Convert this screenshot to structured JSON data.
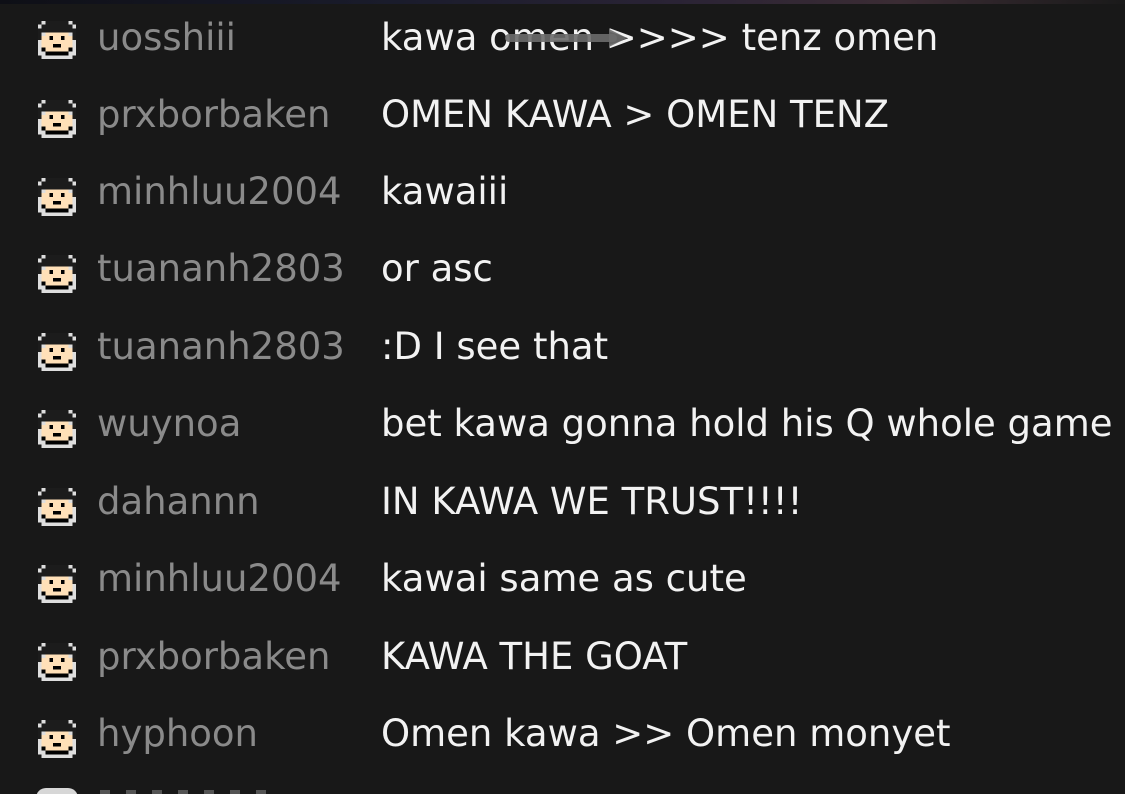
{
  "chat": {
    "messages": [
      {
        "username": "uosshiii",
        "text": "kawa omen >>>> tenz omen",
        "avatar": "pixel-face-avatar"
      },
      {
        "username": "prxborbaken",
        "text": "OMEN KAWA > OMEN TENZ",
        "avatar": "pixel-face-avatar"
      },
      {
        "username": "minhluu2004",
        "text": "kawaiii",
        "avatar": "pixel-face-avatar"
      },
      {
        "username": "tuananh2803",
        "text": "or asc",
        "avatar": "pixel-face-avatar"
      },
      {
        "username": "tuananh2803",
        "text": ":D I see that",
        "avatar": "pixel-face-avatar"
      },
      {
        "username": "wuynoa",
        "text": "bet kawa gonna hold his Q whole game",
        "avatar": "pixel-face-avatar"
      },
      {
        "username": "dahannn",
        "text": "IN KAWA WE TRUST!!!!",
        "avatar": "pixel-face-avatar"
      },
      {
        "username": "minhluu2004",
        "text": "kawai same as cute",
        "avatar": "pixel-face-avatar"
      },
      {
        "username": "prxborbaken",
        "text": "KAWA THE GOAT",
        "avatar": "pixel-face-avatar"
      },
      {
        "username": "hyphoon",
        "text": "Omen kawa >> Omen monyet",
        "avatar": "pixel-face-avatar"
      }
    ]
  },
  "colors": {
    "background": "#181818",
    "username": "#8a8a8a",
    "message": "#f2f2f2",
    "avatar_hair": "#1c1c1c",
    "avatar_skin": "#ffe0b8",
    "avatar_outline": "#000000",
    "avatar_bg": "#dedede"
  }
}
